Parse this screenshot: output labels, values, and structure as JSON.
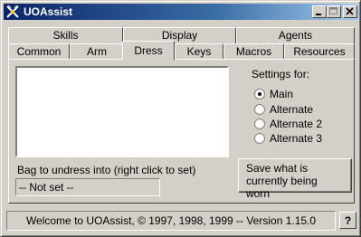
{
  "window": {
    "title": "UOAssist"
  },
  "titlebar": {
    "icons": [
      "app-icon",
      "minimize-icon",
      "maximize-icon",
      "close-icon"
    ]
  },
  "tabs": {
    "row_back": [
      {
        "label": "Skills"
      },
      {
        "label": "Display"
      },
      {
        "label": "Agents"
      }
    ],
    "row_front": [
      {
        "label": "Common"
      },
      {
        "label": "Arm"
      },
      {
        "label": "Dress"
      },
      {
        "label": "Keys"
      },
      {
        "label": "Macros"
      },
      {
        "label": "Resources"
      }
    ],
    "active": "Dress"
  },
  "dress": {
    "settings_label": "Settings for:",
    "options": [
      {
        "label": "Main",
        "selected": true
      },
      {
        "label": "Alternate",
        "selected": false
      },
      {
        "label": "Alternate 2",
        "selected": false
      },
      {
        "label": "Alternate 3",
        "selected": false
      }
    ],
    "bag_label": "Bag to undress into (right click to set)",
    "bag_value": "-- Not set --",
    "save_button": "Save what is currently being worn"
  },
  "status": {
    "text": "Welcome to UOAssist, © 1997, 1998, 1999 -- Version 1.15.0",
    "help_label": "?"
  }
}
